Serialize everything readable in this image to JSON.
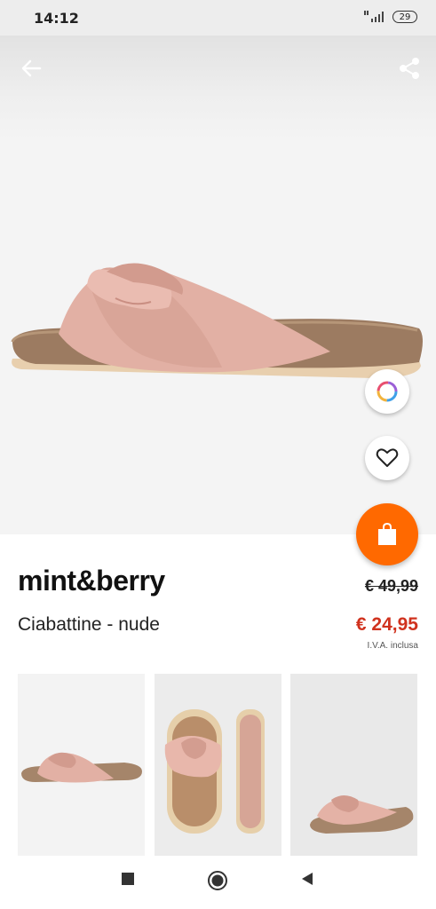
{
  "status_bar": {
    "time": "14:12",
    "battery": "29"
  },
  "product": {
    "brand": "mint&berry",
    "name": "Ciabattine - nude",
    "old_price": "€ 49,99",
    "price": "€ 24,95",
    "vat_note": "I.V.A. inclusa"
  },
  "colors": {
    "accent": "#ff6900",
    "price": "#d0321e",
    "sandal_suede": "#e6b7ac",
    "cork": "#9c7b61"
  },
  "icons": {
    "back": "arrow-left-icon",
    "share": "share-icon",
    "color_picker": "color-ring-icon",
    "wishlist": "heart-icon",
    "cart": "shopping-bag-icon",
    "nav_recent": "square-icon",
    "nav_home": "circle-icon",
    "nav_back": "triangle-back-icon"
  }
}
